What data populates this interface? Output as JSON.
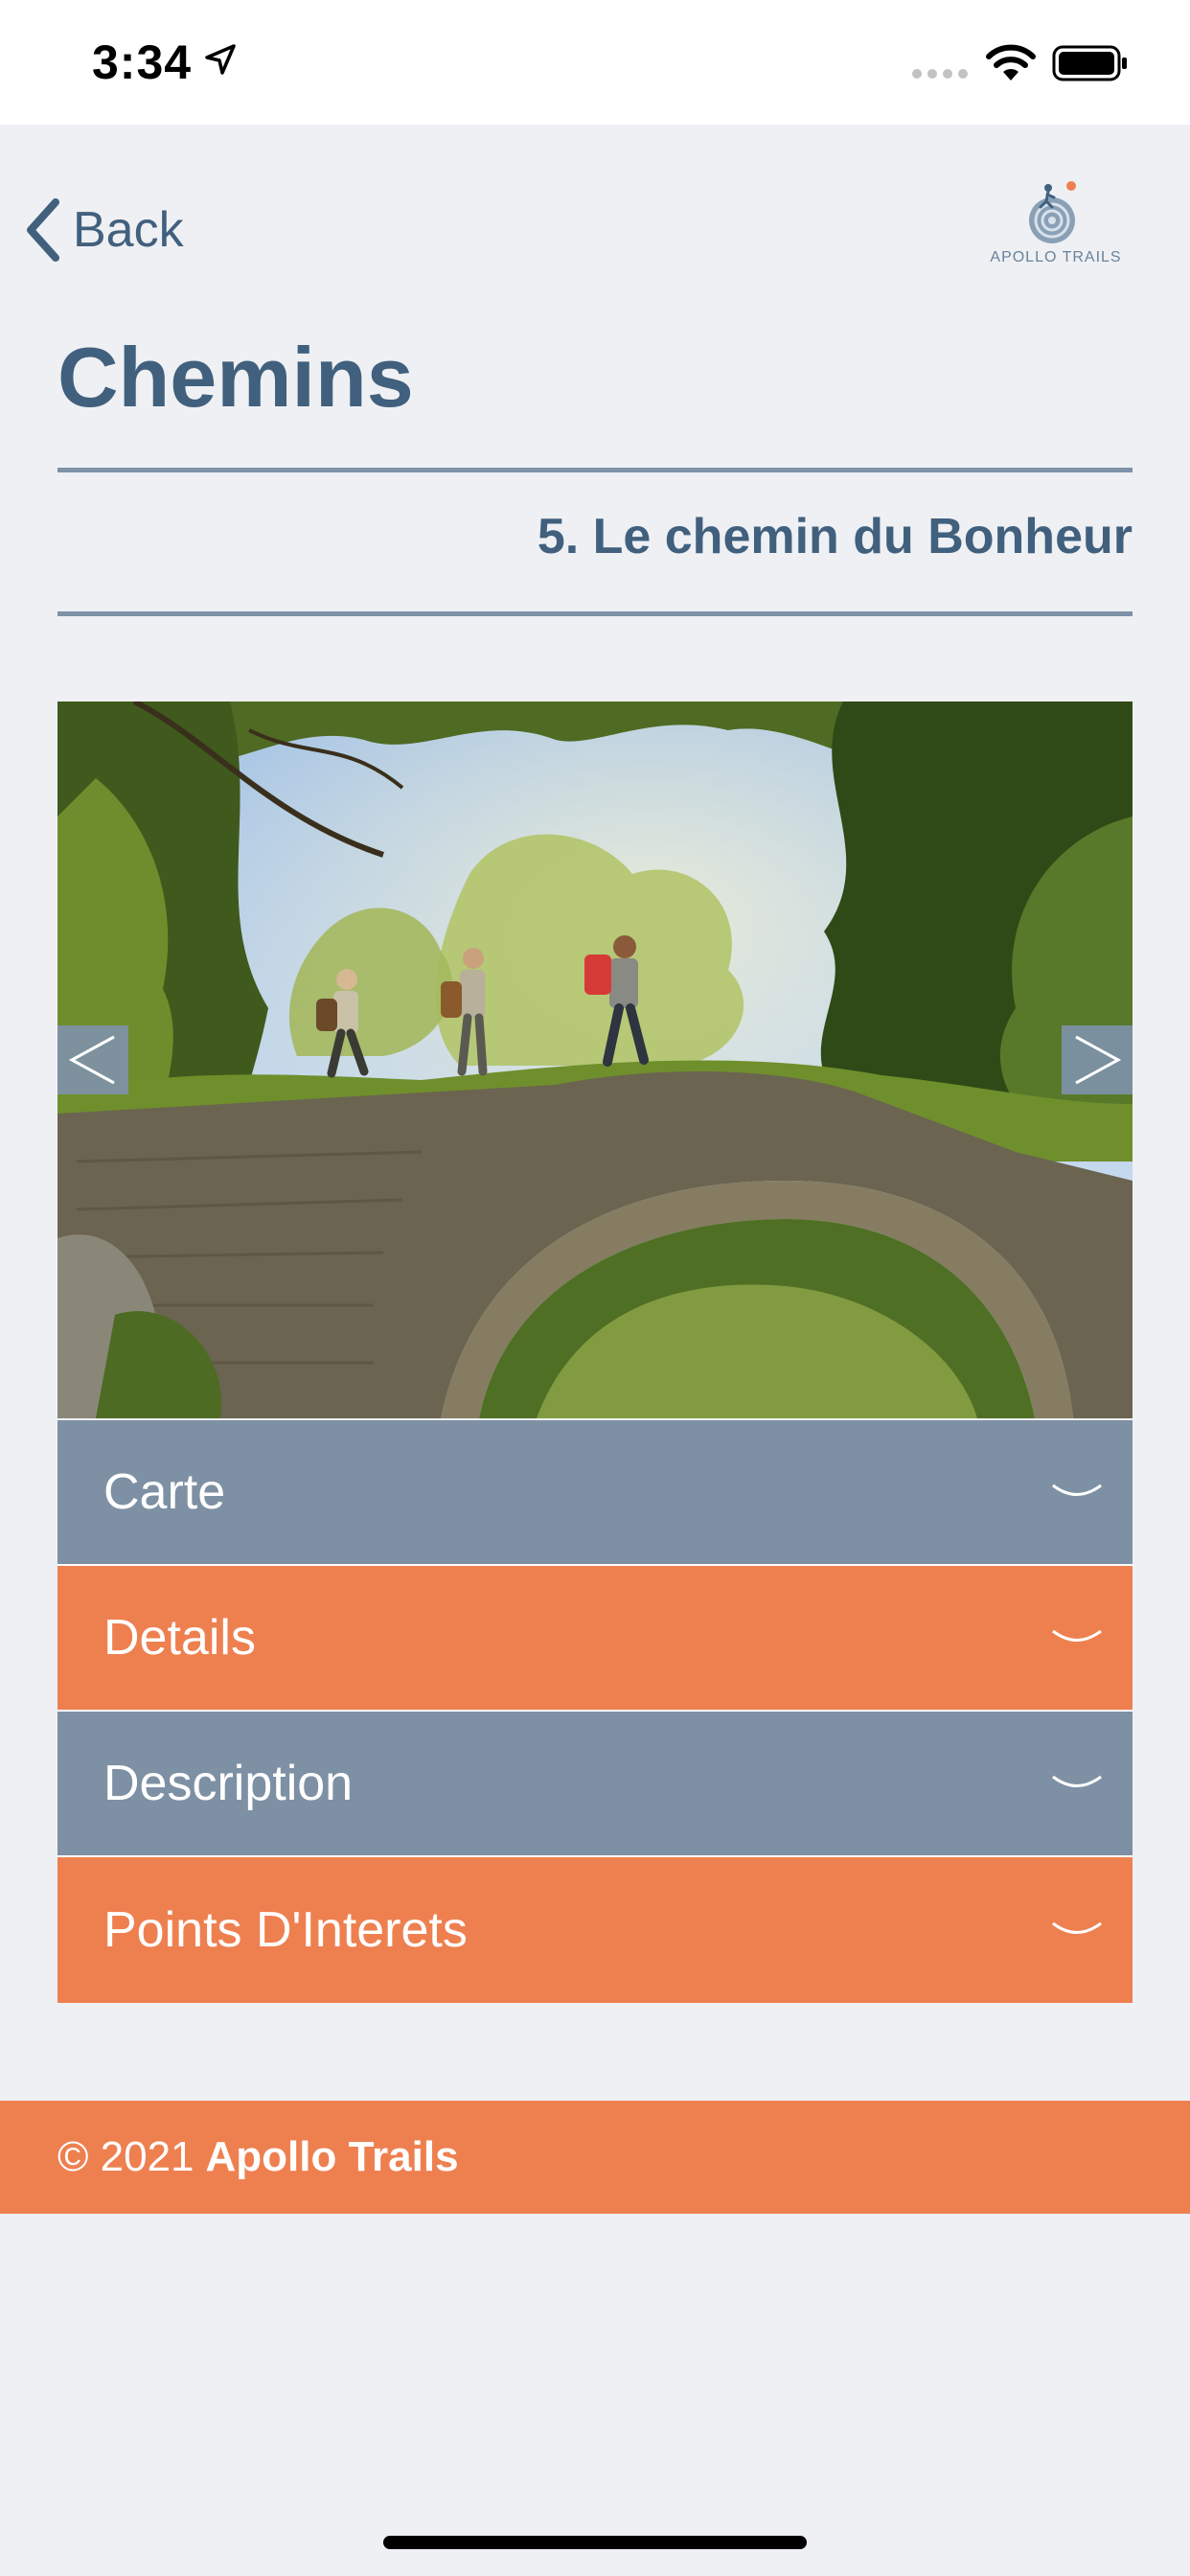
{
  "status_bar": {
    "time": "3:34"
  },
  "nav": {
    "back_label": "Back",
    "logo_text": "APOLLO TRAILS"
  },
  "page": {
    "title": "Chemins",
    "trail_name": "5. Le chemin du Bonheur"
  },
  "carousel": {
    "prev_label": "<",
    "next_label": ">"
  },
  "accordion": {
    "items": [
      {
        "label": "Carte",
        "color": "#7e90a4"
      },
      {
        "label": "Details",
        "color": "#ee8050"
      },
      {
        "label": "Description",
        "color": "#7e90a4"
      },
      {
        "label": "Points D'Interets",
        "color": "#ee8050"
      }
    ]
  },
  "footer": {
    "copyright": "© 2021",
    "brand": "Apollo Trails"
  },
  "colors": {
    "primary": "#41607d",
    "slate": "#7e90a4",
    "accent": "#ee8050",
    "background": "#eef0f4"
  }
}
